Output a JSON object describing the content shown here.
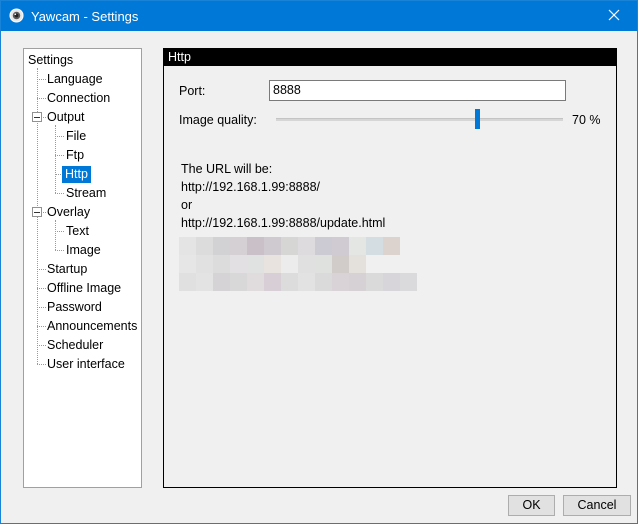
{
  "window": {
    "title": "Yawcam - Settings"
  },
  "tree": {
    "root": "Settings",
    "language": "Language",
    "connection": "Connection",
    "output": "Output",
    "file": "File",
    "ftp": "Ftp",
    "http": "Http",
    "stream": "Stream",
    "overlay": "Overlay",
    "text": "Text",
    "image": "Image",
    "startup": "Startup",
    "offline_image": "Offline Image",
    "password": "Password",
    "announcements": "Announcements",
    "scheduler": "Scheduler",
    "user_interface": "User interface",
    "selected": "Http"
  },
  "panel": {
    "header": "Http",
    "port_label": "Port:",
    "port_value": "8888",
    "quality_label": "Image quality:",
    "quality_value": 70,
    "quality_text": "70 %",
    "url_intro": "The URL will be:",
    "url1": "http://192.168.1.99:8888/",
    "or": "or",
    "url2": "http://192.168.1.99:8888/update.html"
  },
  "buttons": {
    "ok": "OK",
    "cancel": "Cancel"
  },
  "colors": {
    "accent": "#0078d7",
    "header_bg": "#000000"
  },
  "redacted_text": {
    "rows": [
      [
        "#e4e4e4",
        "#dcdcdc",
        "#d2d2d4",
        "#d4d0d4",
        "#c9c0c8",
        "#cfcad0",
        "#d6d7d4",
        "#dddbdd",
        "#cccbd4",
        "#d0cbd2",
        "#e3e6e3",
        "#d3dde2",
        "#dcd3cf"
      ],
      [
        "#e6e6e6",
        "#e1e1e1",
        "#dcdcdc",
        "#e2e0e2",
        "#dfe2e1",
        "#e8e3df",
        "#ececec",
        "#e0e0e0",
        "#dfe1df",
        "#d1ccc9",
        "#e4e0dc"
      ],
      [
        "#e0e0e0",
        "#e3e3e3",
        "#d6d3d6",
        "#d8d8d8",
        "#e0dcde",
        "#d8cfd6",
        "#dcdcdc",
        "#e2e2e2",
        "#dadada",
        "#d9d3d7",
        "#d6d1d4",
        "#dadada",
        "#d8d5da",
        "#dad9dc"
      ]
    ]
  }
}
